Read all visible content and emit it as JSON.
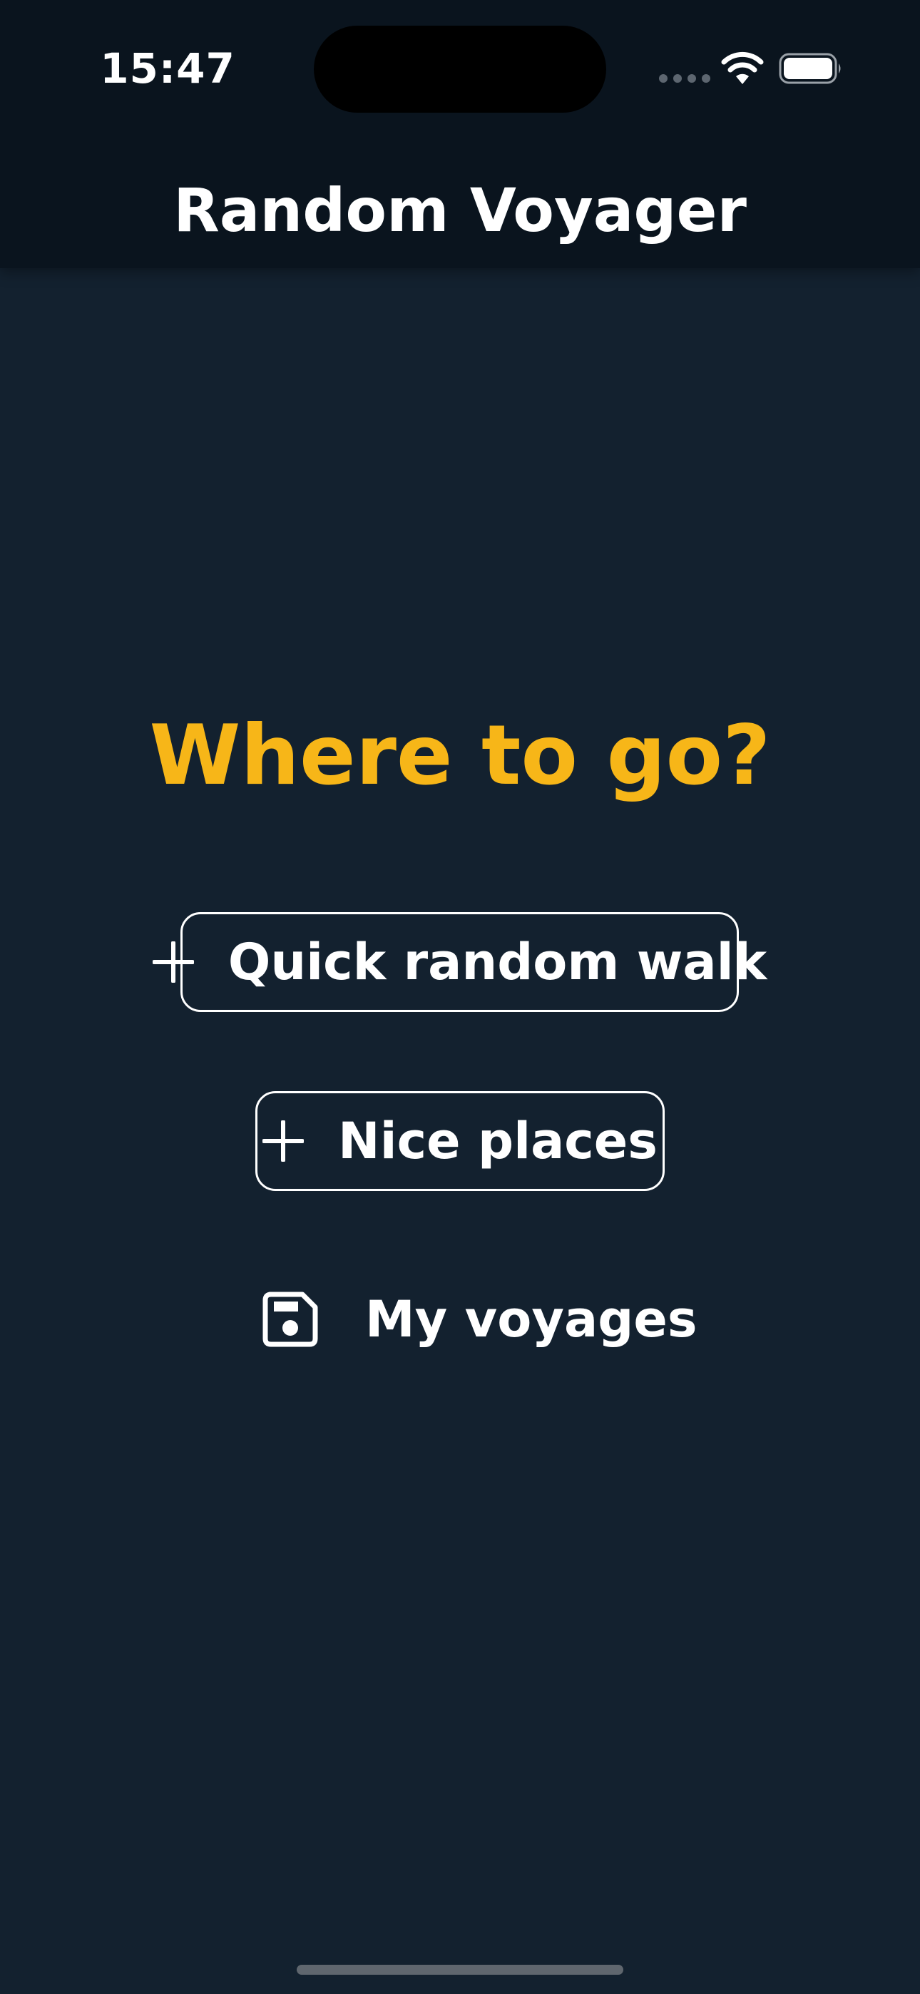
{
  "status_bar": {
    "time": "15:47",
    "icons": [
      "signal-dots-icon",
      "wifi-icon",
      "battery-icon"
    ]
  },
  "header": {
    "title": "Random Voyager"
  },
  "main": {
    "prompt": "Where to go?",
    "quick_walk_label": "Quick random walk",
    "nice_places_label": "Nice places",
    "my_voyages_label": "My voyages"
  },
  "colors": {
    "background": "#13212f",
    "header_background": "#0a141e",
    "accent": "#f7b618",
    "text": "#ffffff"
  }
}
